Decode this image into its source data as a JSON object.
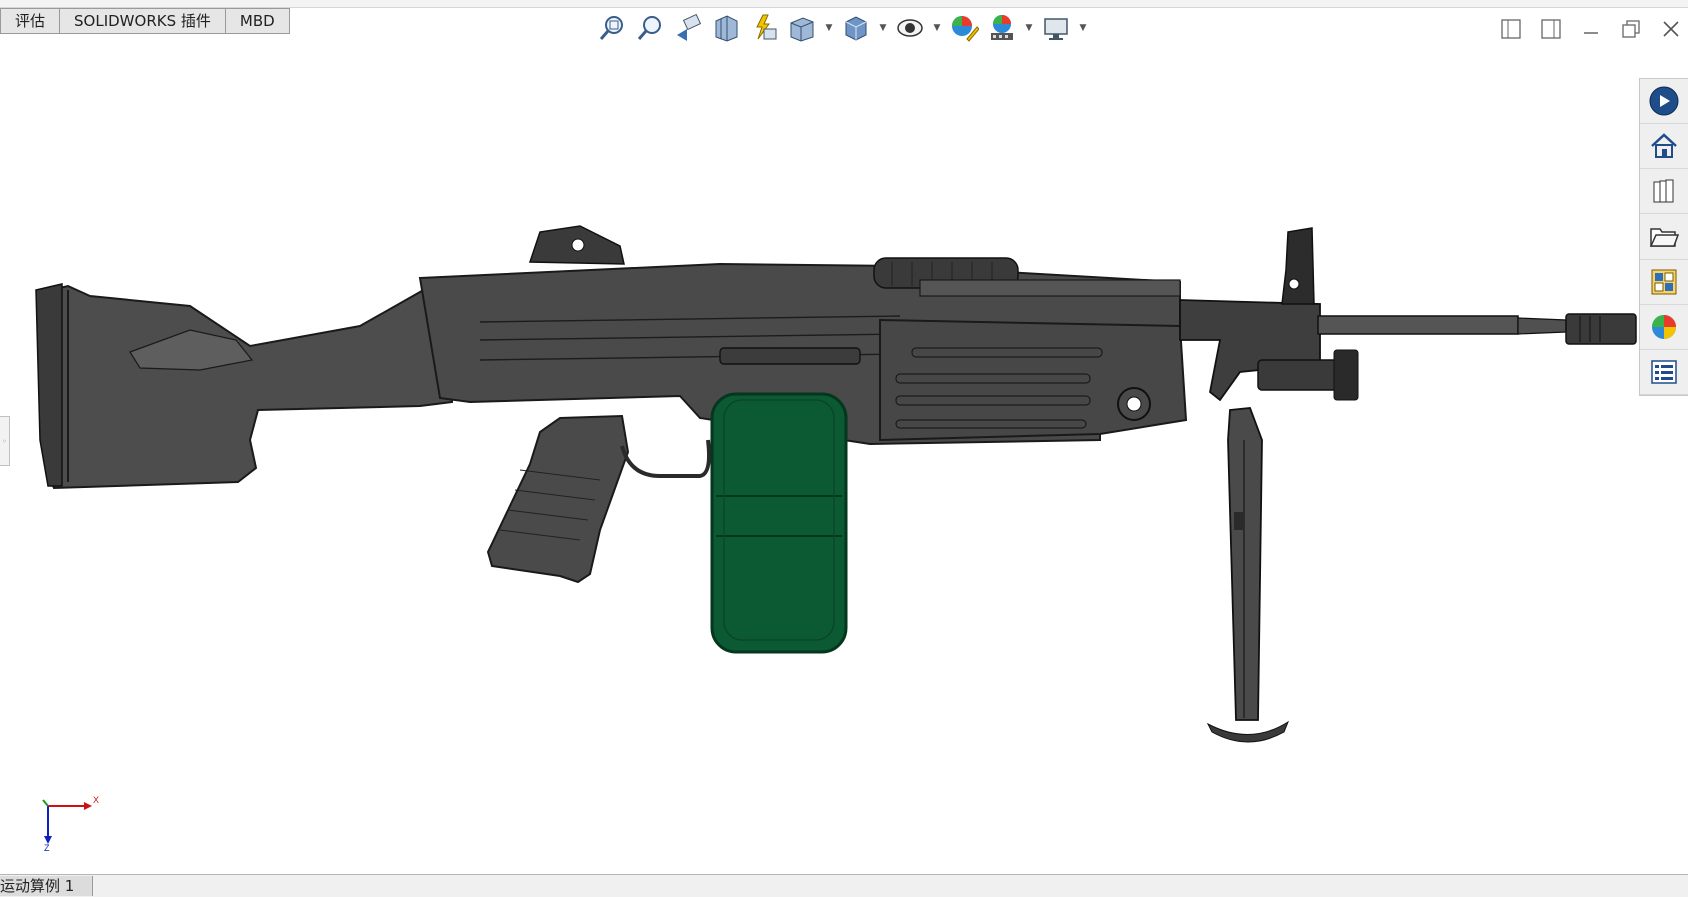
{
  "tabs": [
    {
      "label": "评估"
    },
    {
      "label": "SOLIDWORKS 插件"
    },
    {
      "label": "MBD"
    }
  ],
  "heads_up_toolbar": {
    "icons": [
      "zoom-to-fit-icon",
      "zoom-to-area-icon",
      "previous-view-icon",
      "section-view-icon",
      "dynamic-annotation-icon",
      "view-orientation-icon",
      "display-style-icon",
      "hide-show-items-icon",
      "edit-appearance-icon",
      "apply-scene-icon",
      "view-settings-icon"
    ]
  },
  "window_controls": [
    "tile-left-icon",
    "tile-right-icon",
    "minimize-icon",
    "restore-icon",
    "close-icon"
  ],
  "task_pane": {
    "icons": [
      "solidworks-resources-icon",
      "home-icon",
      "design-library-icon",
      "file-explorer-icon",
      "view-palette-icon",
      "appearances-icon",
      "custom-properties-icon"
    ]
  },
  "triad": {
    "x_label": "X",
    "z_label": "Z"
  },
  "status_tabs": [
    {
      "label": "运动算例 1"
    }
  ],
  "colors": {
    "model_dark": "#4a4a4a",
    "model_edge": "#1a1a1a",
    "ammo_box": "#0c5a34",
    "triad_x": "#d01010",
    "triad_y": "#18a018",
    "triad_z": "#1020c0"
  }
}
